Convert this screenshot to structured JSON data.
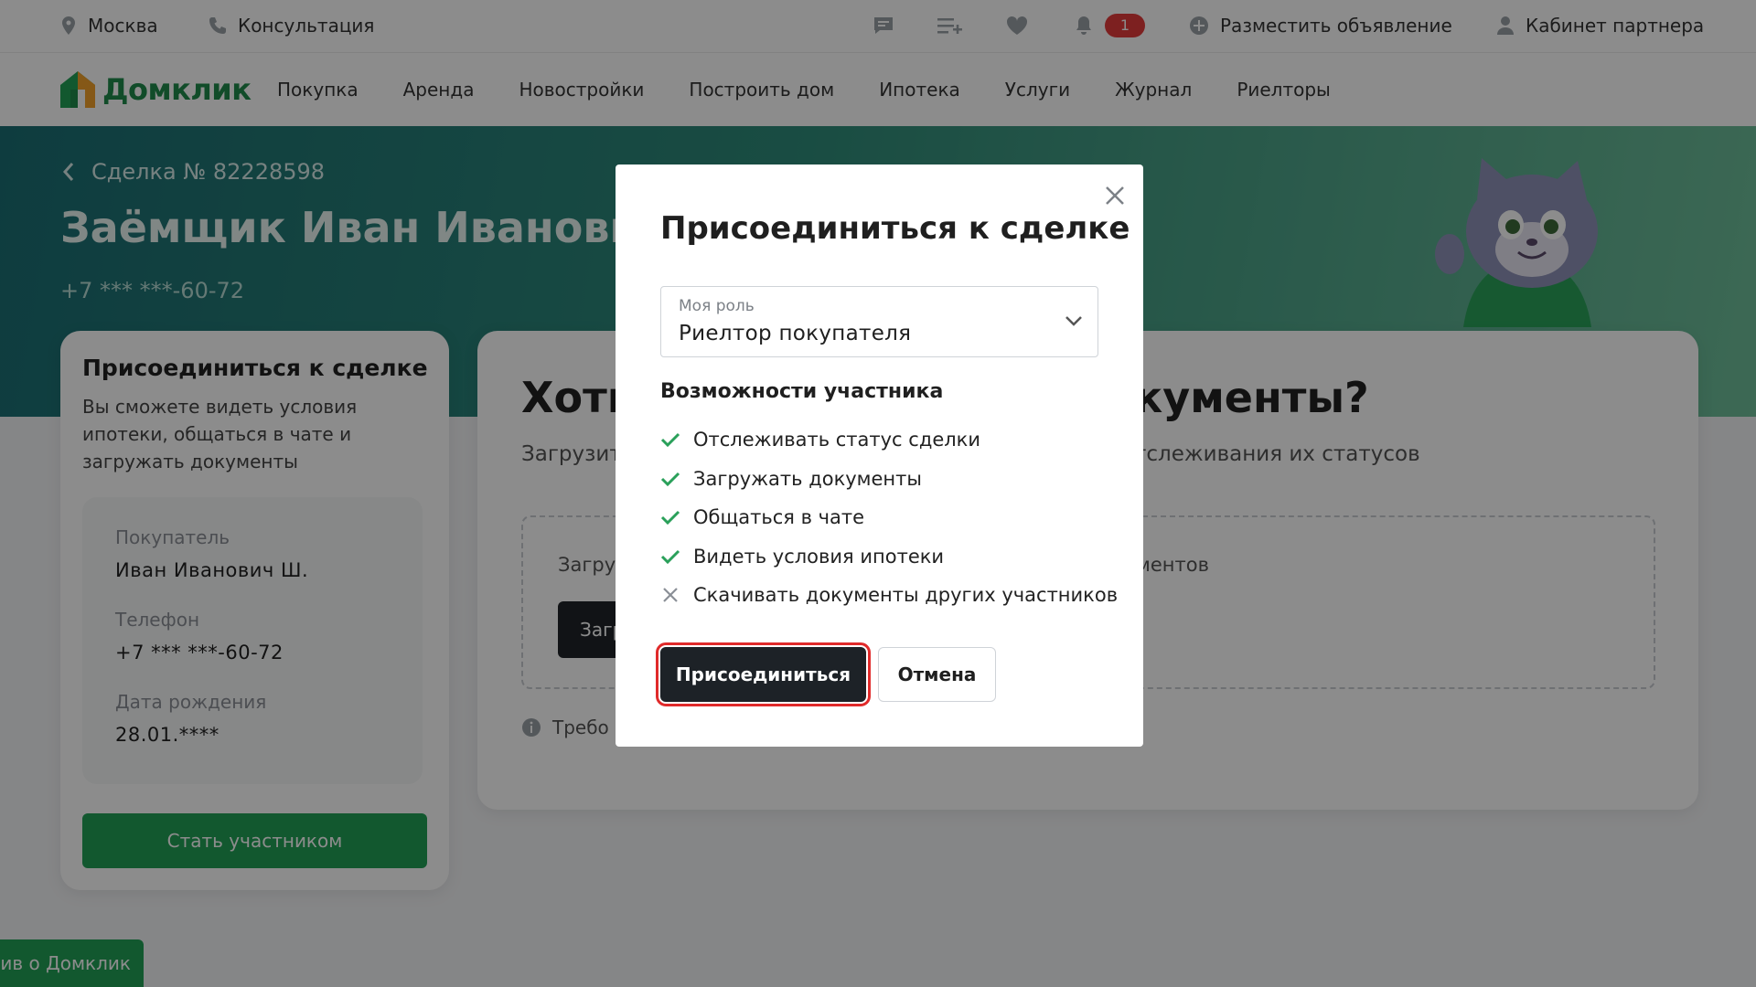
{
  "topbar": {
    "city": "Москва",
    "consultation": "Консультация",
    "notifications_count": "1",
    "post_ad": "Разместить объявление",
    "partner_cabinet": "Кабинет партнера"
  },
  "nav": {
    "logo_text": "Домклик",
    "links": [
      "Покупка",
      "Аренда",
      "Новостройки",
      "Построить дом",
      "Ипотека",
      "Услуги",
      "Журнал",
      "Риелторы"
    ]
  },
  "hero": {
    "breadcrumb": "Сделка № 82228598",
    "title": "Заёмщик Иван Иванович",
    "phone": "+7 *** ***-60-72"
  },
  "left_card": {
    "title": "Присоединиться к сделке",
    "description": "Вы сможете видеть условия ипотеки, общаться в чате и загружать документы",
    "buyer_label": "Покупатель",
    "buyer_value": "Иван Иванович Ш.",
    "phone_label": "Телефон",
    "phone_value": "+7 *** ***-60-72",
    "birth_label": "Дата рождения",
    "birth_value": "28.01.****",
    "button": "Стать участником"
  },
  "right_card": {
    "title_left": "Хоти",
    "title_right": "кументы?",
    "subtitle_left": "Загрузит",
    "subtitle_right": "тслеживания их статусов",
    "dropzone_text_left": "Загру",
    "dropzone_text_right": "ментов",
    "dropzone_button": "Загр",
    "requirements": "Требо"
  },
  "feedback_tab": "ив о Домклик",
  "modal": {
    "title": "Присоединиться к сделке",
    "role_label": "Моя роль",
    "role_value": "Риелтор покупателя",
    "capabilities_title": "Возможности участника",
    "capabilities": [
      {
        "text": "Отслеживать статус сделки",
        "allowed": true
      },
      {
        "text": "Загружать документы",
        "allowed": true
      },
      {
        "text": "Общаться в чате",
        "allowed": true
      },
      {
        "text": "Видеть условия ипотеки",
        "allowed": true
      },
      {
        "text": "Скачивать документы других участников",
        "allowed": false
      }
    ],
    "join_button": "Присоединиться",
    "cancel_button": "Отмена"
  },
  "colors": {
    "brand_green": "#21a056",
    "check_green": "#2aa05a",
    "dark_button": "#1d2227",
    "highlight_red": "#e02a2a",
    "badge_red": "#e33b3b"
  },
  "icons": [
    "location-pin-icon",
    "phone-icon",
    "chat-icon",
    "compare-icon",
    "heart-icon",
    "bell-icon",
    "plus-circle-icon",
    "user-icon",
    "back-chevron-icon",
    "chevron-down-icon",
    "close-icon",
    "check-icon",
    "cross-icon",
    "info-icon"
  ]
}
